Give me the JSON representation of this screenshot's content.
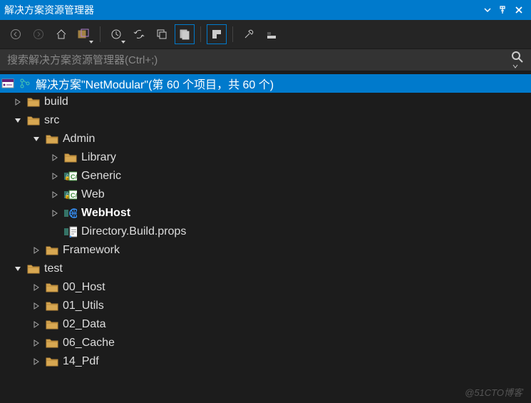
{
  "title": "解决方案资源管理器",
  "search_placeholder": "搜索解决方案资源管理器(Ctrl+;)",
  "solution_label": "解决方案\"NetModular\"(第 60 个项目，共 60 个)",
  "watermark": "@51CTO博客",
  "tree": [
    {
      "depth": 0,
      "caret": "right",
      "icon": "folder",
      "label": "build"
    },
    {
      "depth": 0,
      "caret": "down",
      "icon": "folder",
      "label": "src"
    },
    {
      "depth": 1,
      "caret": "down",
      "icon": "folder",
      "label": "Admin"
    },
    {
      "depth": 2,
      "caret": "right",
      "icon": "folder",
      "label": "Library"
    },
    {
      "depth": 2,
      "caret": "right",
      "icon": "csproj",
      "label": "Generic"
    },
    {
      "depth": 2,
      "caret": "right",
      "icon": "csproj",
      "label": "Web"
    },
    {
      "depth": 2,
      "caret": "right",
      "icon": "webhost",
      "label": "WebHost",
      "bold": true
    },
    {
      "depth": 2,
      "caret": "none",
      "icon": "props",
      "label": "Directory.Build.props"
    },
    {
      "depth": 1,
      "caret": "right",
      "icon": "folder",
      "label": "Framework"
    },
    {
      "depth": 0,
      "caret": "down",
      "icon": "folder",
      "label": "test"
    },
    {
      "depth": 1,
      "caret": "right",
      "icon": "folder",
      "label": "00_Host"
    },
    {
      "depth": 1,
      "caret": "right",
      "icon": "folder",
      "label": "01_Utils"
    },
    {
      "depth": 1,
      "caret": "right",
      "icon": "folder",
      "label": "02_Data"
    },
    {
      "depth": 1,
      "caret": "right",
      "icon": "folder",
      "label": "06_Cache"
    },
    {
      "depth": 1,
      "caret": "right",
      "icon": "folder",
      "label": "14_Pdf"
    }
  ]
}
